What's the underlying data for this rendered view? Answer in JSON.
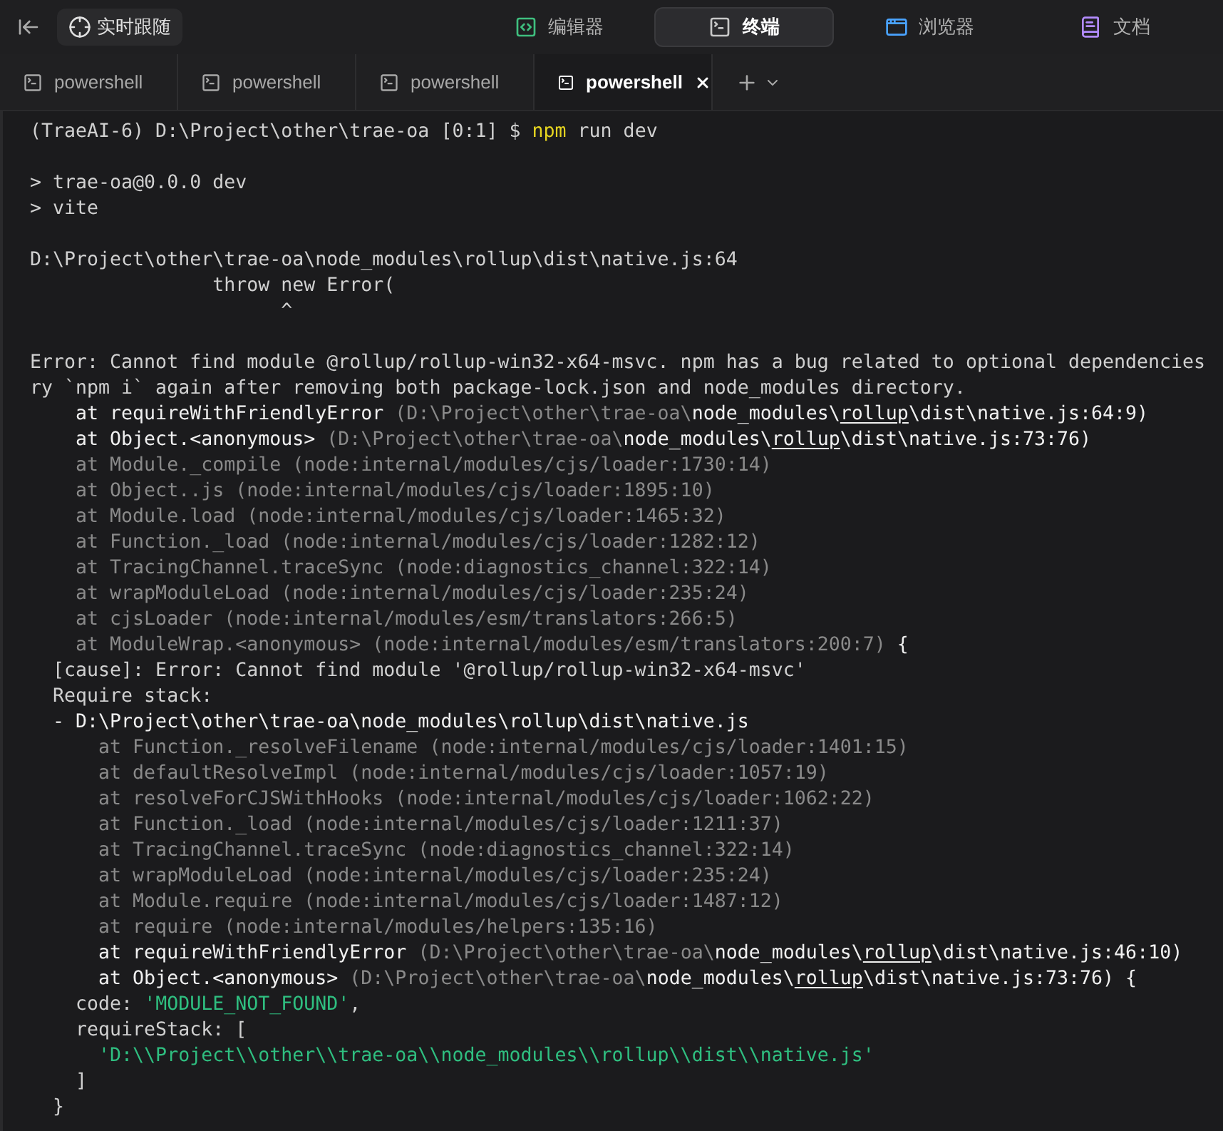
{
  "toolbar": {
    "follow_button": "实时跟随",
    "views": [
      {
        "label": "编辑器",
        "kind": "editor",
        "selected": false
      },
      {
        "label": "终端",
        "kind": "terminal",
        "selected": true
      },
      {
        "label": "浏览器",
        "kind": "browser",
        "selected": false
      },
      {
        "label": "文档",
        "kind": "docs",
        "selected": false
      }
    ]
  },
  "terminal_tabs": [
    {
      "label": "powershell",
      "selected": false
    },
    {
      "label": "powershell",
      "selected": false
    },
    {
      "label": "powershell",
      "selected": false
    },
    {
      "label": "powershell",
      "selected": true
    }
  ],
  "terminal": {
    "lines": [
      {
        "kind": "text",
        "segments": [
          {
            "text": "(TraeAI-6) D:\\Project\\other\\trae-oa [0:1] $ ",
            "kind": "plain"
          },
          {
            "text": "npm",
            "kind": "yellow"
          },
          {
            "text": " run dev",
            "kind": "plain"
          }
        ]
      },
      {
        "kind": "blank"
      },
      {
        "kind": "text",
        "segments": [
          {
            "text": "> trae-oa@0.0.0 dev",
            "kind": "plain"
          }
        ]
      },
      {
        "kind": "text",
        "segments": [
          {
            "text": "> vite",
            "kind": "plain"
          }
        ]
      },
      {
        "kind": "blank"
      },
      {
        "kind": "text",
        "segments": [
          {
            "text": "D:\\Project\\other\\trae-oa\\node_modules\\rollup\\dist\\native.js:64",
            "kind": "plain"
          }
        ]
      },
      {
        "kind": "text",
        "segments": [
          {
            "text": "                throw new Error(",
            "kind": "plain"
          }
        ]
      },
      {
        "kind": "text",
        "segments": [
          {
            "text": "                      ^",
            "kind": "plain"
          }
        ]
      },
      {
        "kind": "blank"
      },
      {
        "kind": "text",
        "segments": [
          {
            "text": "Error: Cannot find module @rollup/rollup-win32-x64-msvc. npm has a bug related to optional dependencies",
            "kind": "plain"
          }
        ]
      },
      {
        "kind": "text",
        "segments": [
          {
            "text": "ry `npm i` again after removing both package-lock.json and node_modules directory.",
            "kind": "plain"
          }
        ]
      },
      {
        "kind": "text",
        "segments": [
          {
            "text": "    at requireWithFriendlyError",
            "kind": "bright"
          },
          {
            "text": " (D:\\Project\\other\\trae-oa\\",
            "kind": "dim"
          },
          {
            "text": "node_modules\\",
            "kind": "bright"
          },
          {
            "text": "rollup",
            "kind": "link"
          },
          {
            "text": "\\dist\\native.js:64:9)",
            "kind": "bright"
          }
        ]
      },
      {
        "kind": "text",
        "segments": [
          {
            "text": "    at Object.<anonymous>",
            "kind": "bright"
          },
          {
            "text": " (D:\\Project\\other\\trae-oa\\",
            "kind": "dim"
          },
          {
            "text": "node_modules\\",
            "kind": "bright"
          },
          {
            "text": "rollup",
            "kind": "link"
          },
          {
            "text": "\\dist\\native.js:73:76)",
            "kind": "bright"
          }
        ]
      },
      {
        "kind": "text",
        "segments": [
          {
            "text": "    at Module._compile (node:internal/modules/cjs/loader:1730:14)",
            "kind": "dim"
          }
        ]
      },
      {
        "kind": "text",
        "segments": [
          {
            "text": "    at Object..js (node:internal/modules/cjs/loader:1895:10)",
            "kind": "dim"
          }
        ]
      },
      {
        "kind": "text",
        "segments": [
          {
            "text": "    at Module.load (node:internal/modules/cjs/loader:1465:32)",
            "kind": "dim"
          }
        ]
      },
      {
        "kind": "text",
        "segments": [
          {
            "text": "    at Function._load (node:internal/modules/cjs/loader:1282:12)",
            "kind": "dim"
          }
        ]
      },
      {
        "kind": "text",
        "segments": [
          {
            "text": "    at TracingChannel.traceSync (node:diagnostics_channel:322:14)",
            "kind": "dim"
          }
        ]
      },
      {
        "kind": "text",
        "segments": [
          {
            "text": "    at wrapModuleLoad (node:internal/modules/cjs/loader:235:24)",
            "kind": "dim"
          }
        ]
      },
      {
        "kind": "text",
        "segments": [
          {
            "text": "    at cjsLoader (node:internal/modules/esm/translators:266:5)",
            "kind": "dim"
          }
        ]
      },
      {
        "kind": "text",
        "segments": [
          {
            "text": "    at ModuleWrap.<anonymous> (node:internal/modules/esm/translators:200:7)",
            "kind": "dim"
          },
          {
            "text": " {",
            "kind": "bright"
          }
        ]
      },
      {
        "kind": "text",
        "segments": [
          {
            "text": "  [cause]: Error: Cannot find module '@rollup/rollup-win32-x64-msvc'",
            "kind": "plain"
          }
        ]
      },
      {
        "kind": "text",
        "segments": [
          {
            "text": "  Require stack:",
            "kind": "plain"
          }
        ]
      },
      {
        "kind": "text",
        "segments": [
          {
            "text": "  - D:\\Project\\other\\trae-oa\\node_modules\\rollup\\dist\\native.js",
            "kind": "bright"
          }
        ]
      },
      {
        "kind": "text",
        "segments": [
          {
            "text": "      at Function._resolveFilename (node:internal/modules/cjs/loader:1401:15)",
            "kind": "dim"
          }
        ]
      },
      {
        "kind": "text",
        "segments": [
          {
            "text": "      at defaultResolveImpl (node:internal/modules/cjs/loader:1057:19)",
            "kind": "dim"
          }
        ]
      },
      {
        "kind": "text",
        "segments": [
          {
            "text": "      at resolveForCJSWithHooks (node:internal/modules/cjs/loader:1062:22)",
            "kind": "dim"
          }
        ]
      },
      {
        "kind": "text",
        "segments": [
          {
            "text": "      at Function._load (node:internal/modules/cjs/loader:1211:37)",
            "kind": "dim"
          }
        ]
      },
      {
        "kind": "text",
        "segments": [
          {
            "text": "      at TracingChannel.traceSync (node:diagnostics_channel:322:14)",
            "kind": "dim"
          }
        ]
      },
      {
        "kind": "text",
        "segments": [
          {
            "text": "      at wrapModuleLoad (node:internal/modules/cjs/loader:235:24)",
            "kind": "dim"
          }
        ]
      },
      {
        "kind": "text",
        "segments": [
          {
            "text": "      at Module.require (node:internal/modules/cjs/loader:1487:12)",
            "kind": "dim"
          }
        ]
      },
      {
        "kind": "text",
        "segments": [
          {
            "text": "      at require (node:internal/modules/helpers:135:16)",
            "kind": "dim"
          }
        ]
      },
      {
        "kind": "text",
        "segments": [
          {
            "text": "      at requireWithFriendlyError",
            "kind": "bright"
          },
          {
            "text": " (D:\\Project\\other\\trae-oa\\",
            "kind": "dim"
          },
          {
            "text": "node_modules\\",
            "kind": "bright"
          },
          {
            "text": "rollup",
            "kind": "link"
          },
          {
            "text": "\\dist\\native.js:46:10)",
            "kind": "bright"
          }
        ]
      },
      {
        "kind": "text",
        "segments": [
          {
            "text": "      at Object.<anonymous>",
            "kind": "bright"
          },
          {
            "text": " (D:\\Project\\other\\trae-oa\\",
            "kind": "dim"
          },
          {
            "text": "node_modules\\",
            "kind": "bright"
          },
          {
            "text": "rollup",
            "kind": "link"
          },
          {
            "text": "\\dist\\native.js:73:76) {",
            "kind": "bright"
          }
        ]
      },
      {
        "kind": "text",
        "segments": [
          {
            "text": "    code: ",
            "kind": "plain"
          },
          {
            "text": "'MODULE_NOT_FOUND'",
            "kind": "green"
          },
          {
            "text": ",",
            "kind": "plain"
          }
        ]
      },
      {
        "kind": "text",
        "segments": [
          {
            "text": "    requireStack: [",
            "kind": "plain"
          }
        ]
      },
      {
        "kind": "text",
        "segments": [
          {
            "text": "      'D:\\\\Project\\\\other\\\\trae-oa\\\\node_modules\\\\rollup\\\\dist\\\\native.js'",
            "kind": "green"
          }
        ]
      },
      {
        "kind": "text",
        "segments": [
          {
            "text": "    ]",
            "kind": "plain"
          }
        ]
      },
      {
        "kind": "text",
        "segments": [
          {
            "text": "  }",
            "kind": "plain"
          }
        ]
      }
    ]
  }
}
